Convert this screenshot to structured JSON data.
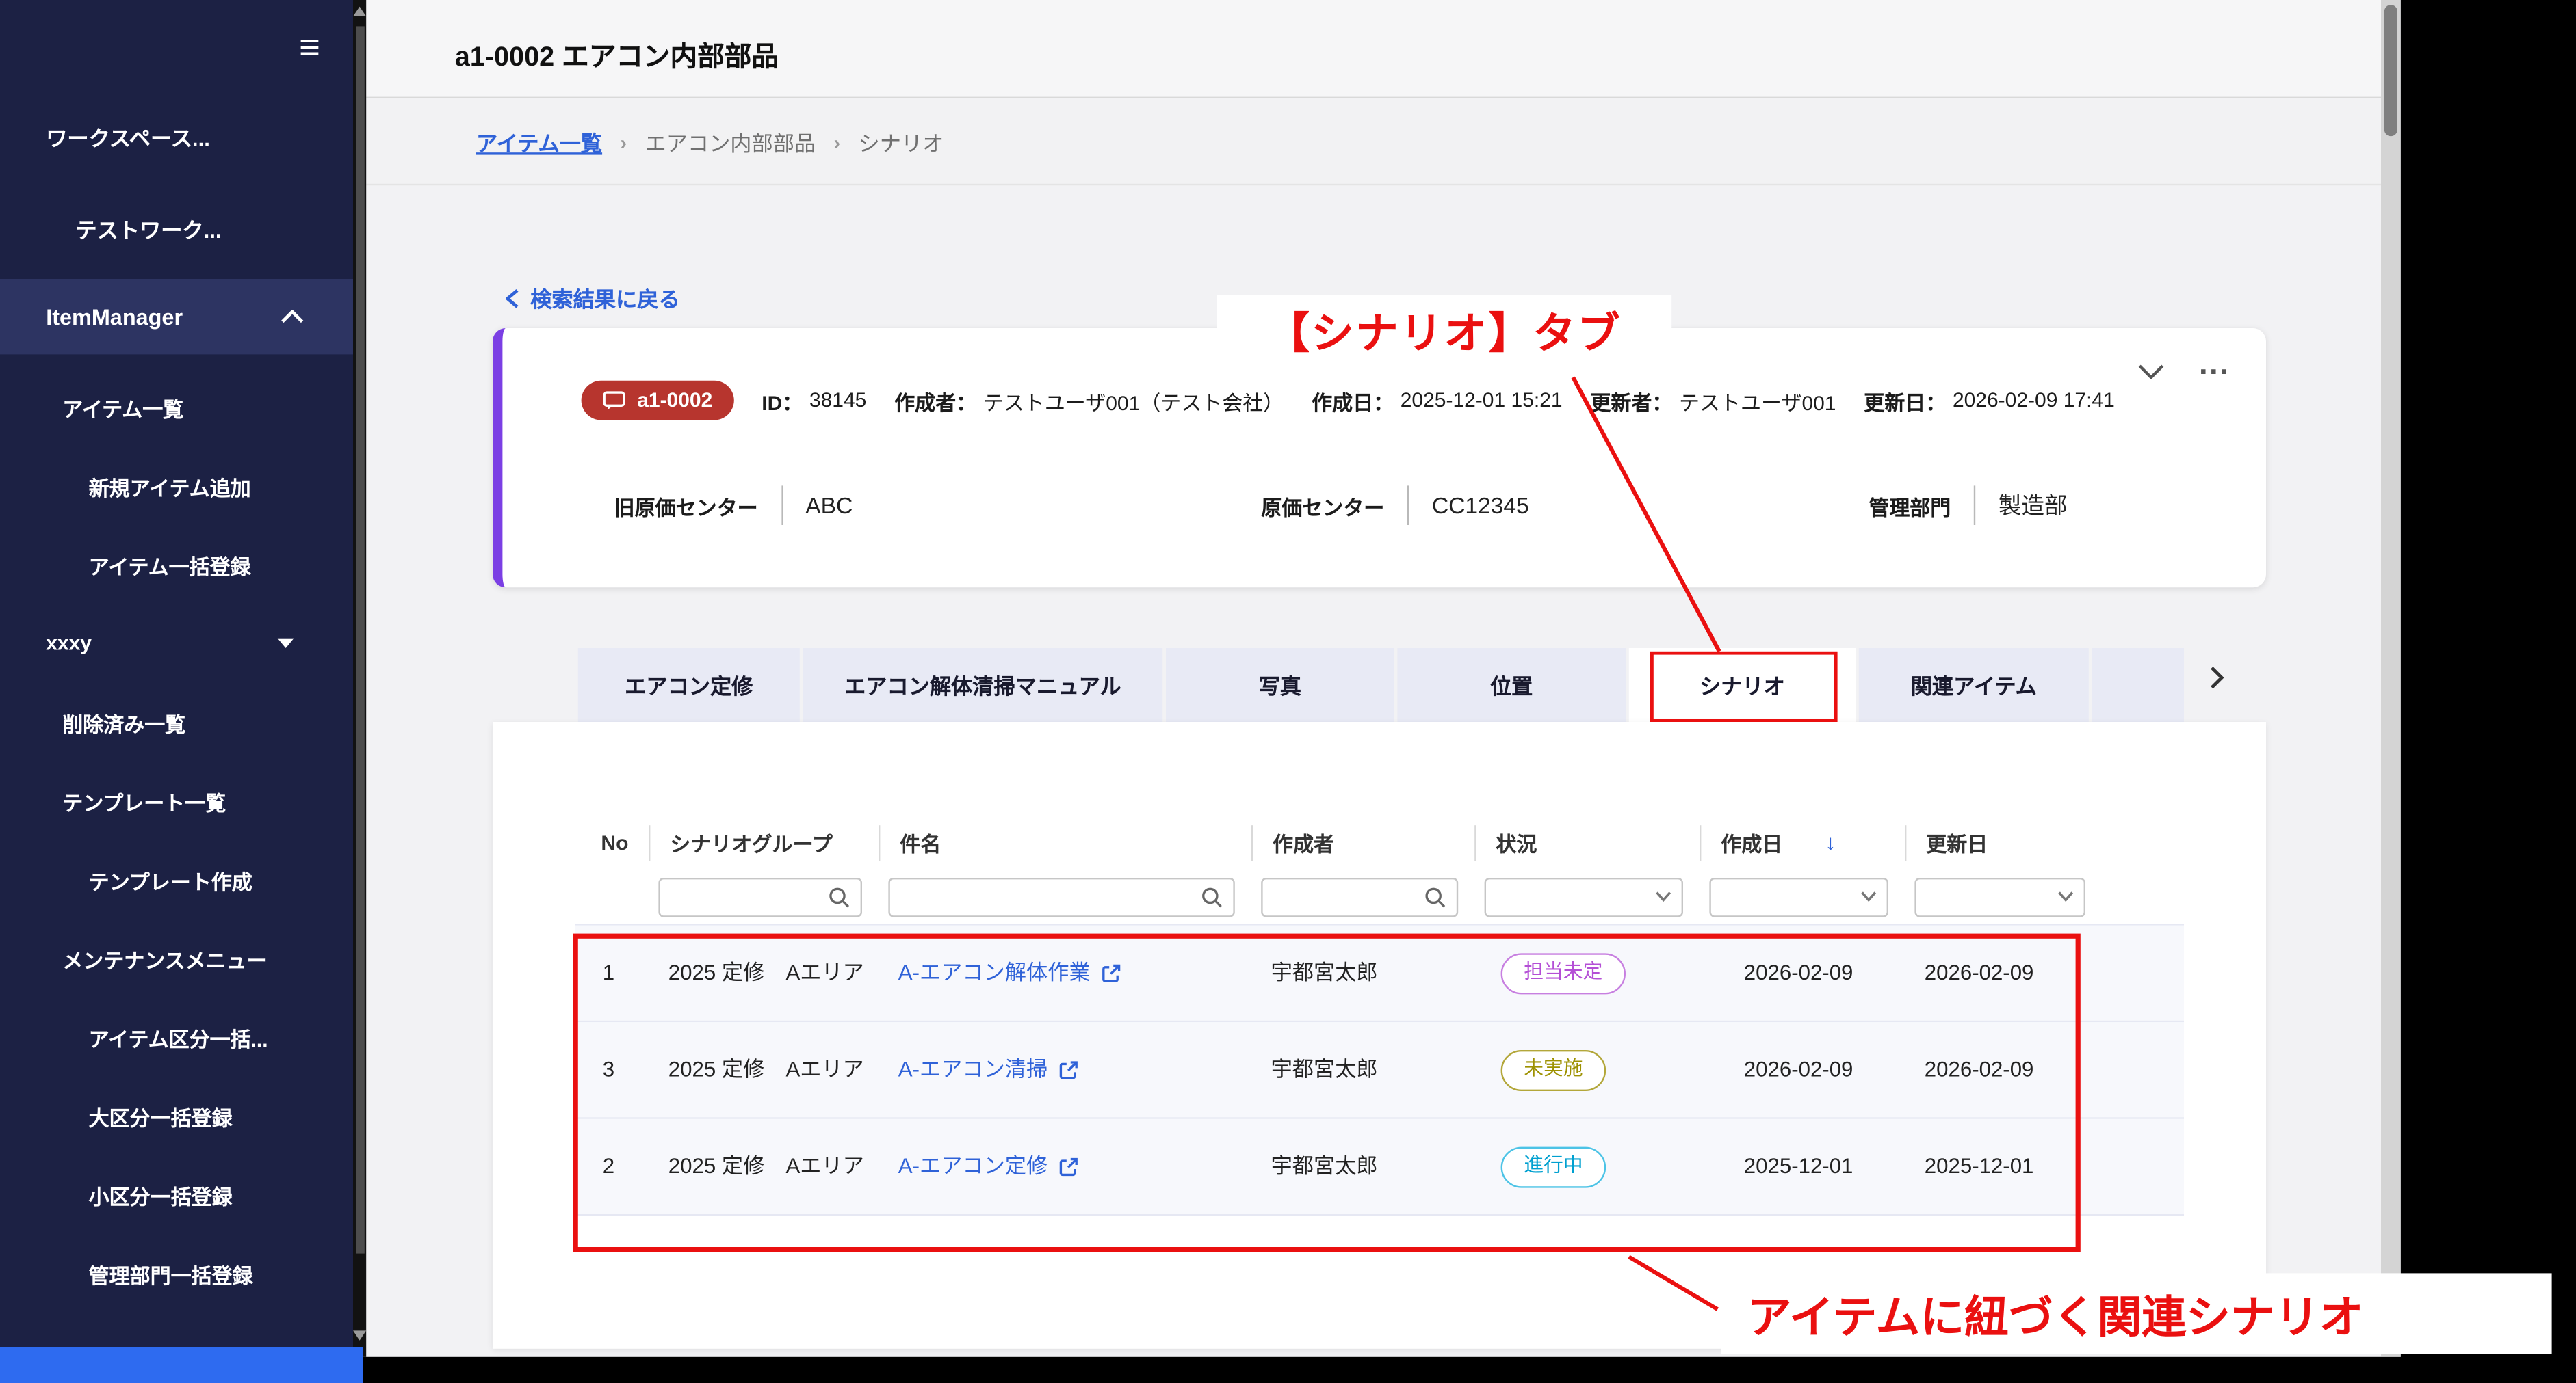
{
  "window": {
    "title": "a1-0002 エアコン内部部品"
  },
  "icons": {
    "menu": "≡",
    "more": "...",
    "sort_desc": "↓",
    "crumb_sep": "›"
  },
  "colors": {
    "sidebar_bg": "#1c2144",
    "sidebar_active_bg": "#2d3462",
    "card_accent": "#7b3fe4",
    "badge_red": "#b7352e",
    "link_blue": "#2f62d8",
    "annotation_red": "#ea1010",
    "tab_inactive_bg": "#e8eaf5",
    "status_purple": "#b44fd6",
    "status_olive": "#9d9100",
    "status_cyan": "#00a0d0"
  },
  "sidebar": {
    "workspace_section": "ワークスペース...",
    "workspace_item": "テストワーク...",
    "app_item": "ItemManager",
    "items": [
      "アイテム一覧",
      "新規アイテム追加",
      "アイテム一括登録",
      "xxxy",
      "削除済み一覧",
      "テンプレート一覧",
      "テンプレート作成",
      "メンテナンスメニュー",
      "アイテム区分一括...",
      "大区分一括登録",
      "小区分一括登録",
      "管理部門一括登録"
    ]
  },
  "breadcrumb": {
    "link": "アイテム一覧",
    "middle": "エアコン内部部品",
    "current": "シナリオ"
  },
  "back_link": "検索結果に戻る",
  "item_card": {
    "badge": "a1-0002",
    "meta": [
      {
        "label": "ID：",
        "value": "38145"
      },
      {
        "label": "作成者：",
        "value": "テストユーザ001（テスト会社）"
      },
      {
        "label": "作成日：",
        "value": "2025-12-01 15:21"
      },
      {
        "label": "更新者：",
        "value": "テストユーザ001"
      },
      {
        "label": "更新日：",
        "value": "2026-02-09 17:41"
      }
    ],
    "attributes": [
      {
        "label": "旧原価センター",
        "value": "ABC"
      },
      {
        "label": "原価センター",
        "value": "CC12345"
      },
      {
        "label": "管理部門",
        "value": "製造部"
      }
    ]
  },
  "tabs": {
    "items": [
      "エアコン定修",
      "エアコン解体清掃マニュアル",
      "写真",
      "位置",
      "シナリオ",
      "関連アイテム"
    ],
    "active": "シナリオ"
  },
  "table": {
    "columns": [
      "No",
      "シナリオグループ",
      "件名",
      "作成者",
      "状況",
      "作成日",
      "更新日"
    ],
    "sort": {
      "column": "作成日",
      "direction": "desc"
    },
    "rows": [
      {
        "no": "1",
        "group": "2025 定修　Aエリア",
        "subject": "A-エアコン解体作業",
        "author": "宇都宮太郎",
        "status": "担当未定",
        "status_variant": "purple",
        "created": "2026-02-09",
        "updated": "2026-02-09"
      },
      {
        "no": "3",
        "group": "2025 定修　Aエリア",
        "subject": "A-エアコン清掃",
        "author": "宇都宮太郎",
        "status": "未実施",
        "status_variant": "olive",
        "created": "2026-02-09",
        "updated": "2026-02-09"
      },
      {
        "no": "2",
        "group": "2025 定修　Aエリア",
        "subject": "A-エアコン定修",
        "author": "宇都宮太郎",
        "status": "進行中",
        "status_variant": "cyan",
        "created": "2025-12-01",
        "updated": "2025-12-01"
      }
    ]
  },
  "annotations": {
    "tab_callout": "【シナリオ】タブ",
    "table_callout": "アイテムに紐づく関連シナリオ"
  }
}
